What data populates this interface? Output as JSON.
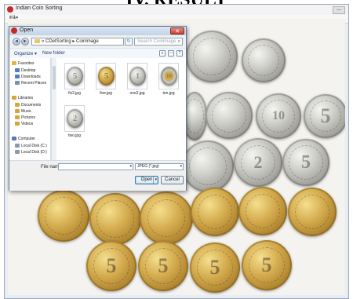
{
  "heading": "IV. RESULT",
  "app": {
    "title": "Indian Coin Sorting",
    "menu": "File",
    "close_glyph": "—"
  },
  "dialog": {
    "title": "Open",
    "close_glyph": "✕",
    "back_glyph": "◄",
    "forward_glyph": "►",
    "address": "« CDetSorting ▸ Coinlmage",
    "refresh_glyph": "↻",
    "search_placeholder": "Search Coinlmage",
    "search_glyph": "⌕",
    "toolbar": {
      "organize": "Organize ▾",
      "new_folder": "New folder",
      "view_glyph": "≡",
      "pane_glyph": "□",
      "help_glyph": "?"
    },
    "nav": [
      {
        "label": "Favorites",
        "icon": "star-icon",
        "color": "#e8b53a"
      },
      {
        "label": "Desktop",
        "icon": "desktop-icon",
        "color": "#4a7fc0"
      },
      {
        "label": "Downloads",
        "icon": "downloads-icon",
        "color": "#4a7fc0"
      },
      {
        "label": "Recent Places",
        "icon": "recent-places-icon",
        "color": "#7a8fa8"
      },
      {
        "label": "Libraries",
        "icon": "libraries-icon",
        "color": "#d8a53c"
      },
      {
        "label": "Documents",
        "icon": "documents-icon",
        "color": "#d8a53c"
      },
      {
        "label": "Music",
        "icon": "music-icon",
        "color": "#d8a53c"
      },
      {
        "label": "Pictures",
        "icon": "pictures-icon",
        "color": "#d8a53c"
      },
      {
        "label": "Videos",
        "icon": "videos-icon",
        "color": "#d8a53c"
      },
      {
        "label": "Computer",
        "icon": "computer-icon",
        "color": "#5a7aa8"
      },
      {
        "label": "Local Disk (C:)",
        "icon": "disk-icon",
        "color": "#8a9aa8"
      },
      {
        "label": "Local Disk (D:)",
        "icon": "disk-icon",
        "color": "#8a9aa8"
      }
    ],
    "files": [
      {
        "name": "fiv2.jpg",
        "type": "silver",
        "mark": "5"
      },
      {
        "name": "five.jpg",
        "type": "gold",
        "mark": "5"
      },
      {
        "name": "one2.jpg",
        "type": "silver",
        "mark": "1"
      },
      {
        "name": "ten.jpg",
        "type": "silver",
        "mark": "10"
      },
      {
        "name": "two.jpg",
        "type": "silver",
        "mark": "2"
      }
    ],
    "filename_label": "File name:",
    "filename_value": "",
    "dropdown_glyph": "▾",
    "filetype": "JPEG (*.jpg)",
    "open_label": "Open",
    "cancel_label": "Cancel"
  },
  "coin_marks": [
    "5",
    "5",
    "10",
    "5",
    "5",
    "2",
    "5",
    "5",
    "5",
    "5"
  ]
}
